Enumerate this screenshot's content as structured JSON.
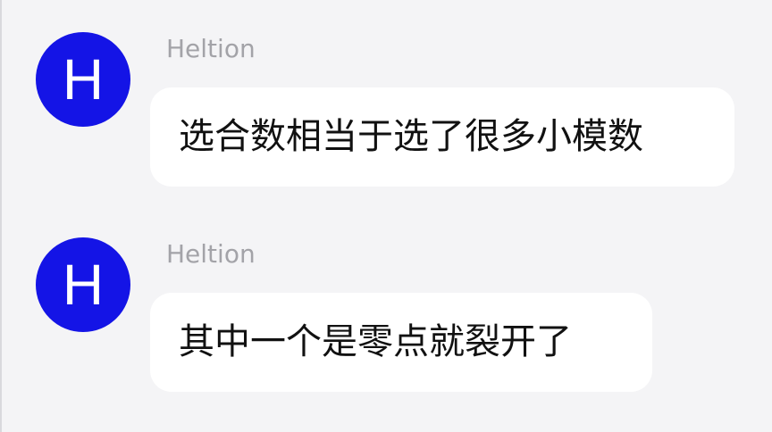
{
  "colors": {
    "background": "#f4f4f6",
    "avatar_background": "#1414e6",
    "avatar_letter": "#ffffff",
    "sender_name": "#a3a3a8",
    "bubble_background": "#ffffff",
    "message_text": "#111111"
  },
  "messages": [
    {
      "avatar_letter": "H",
      "sender": "Heltion",
      "text": "选合数相当于选了很多小模数"
    },
    {
      "avatar_letter": "H",
      "sender": "Heltion",
      "text": "其中一个是零点就裂开了"
    }
  ]
}
